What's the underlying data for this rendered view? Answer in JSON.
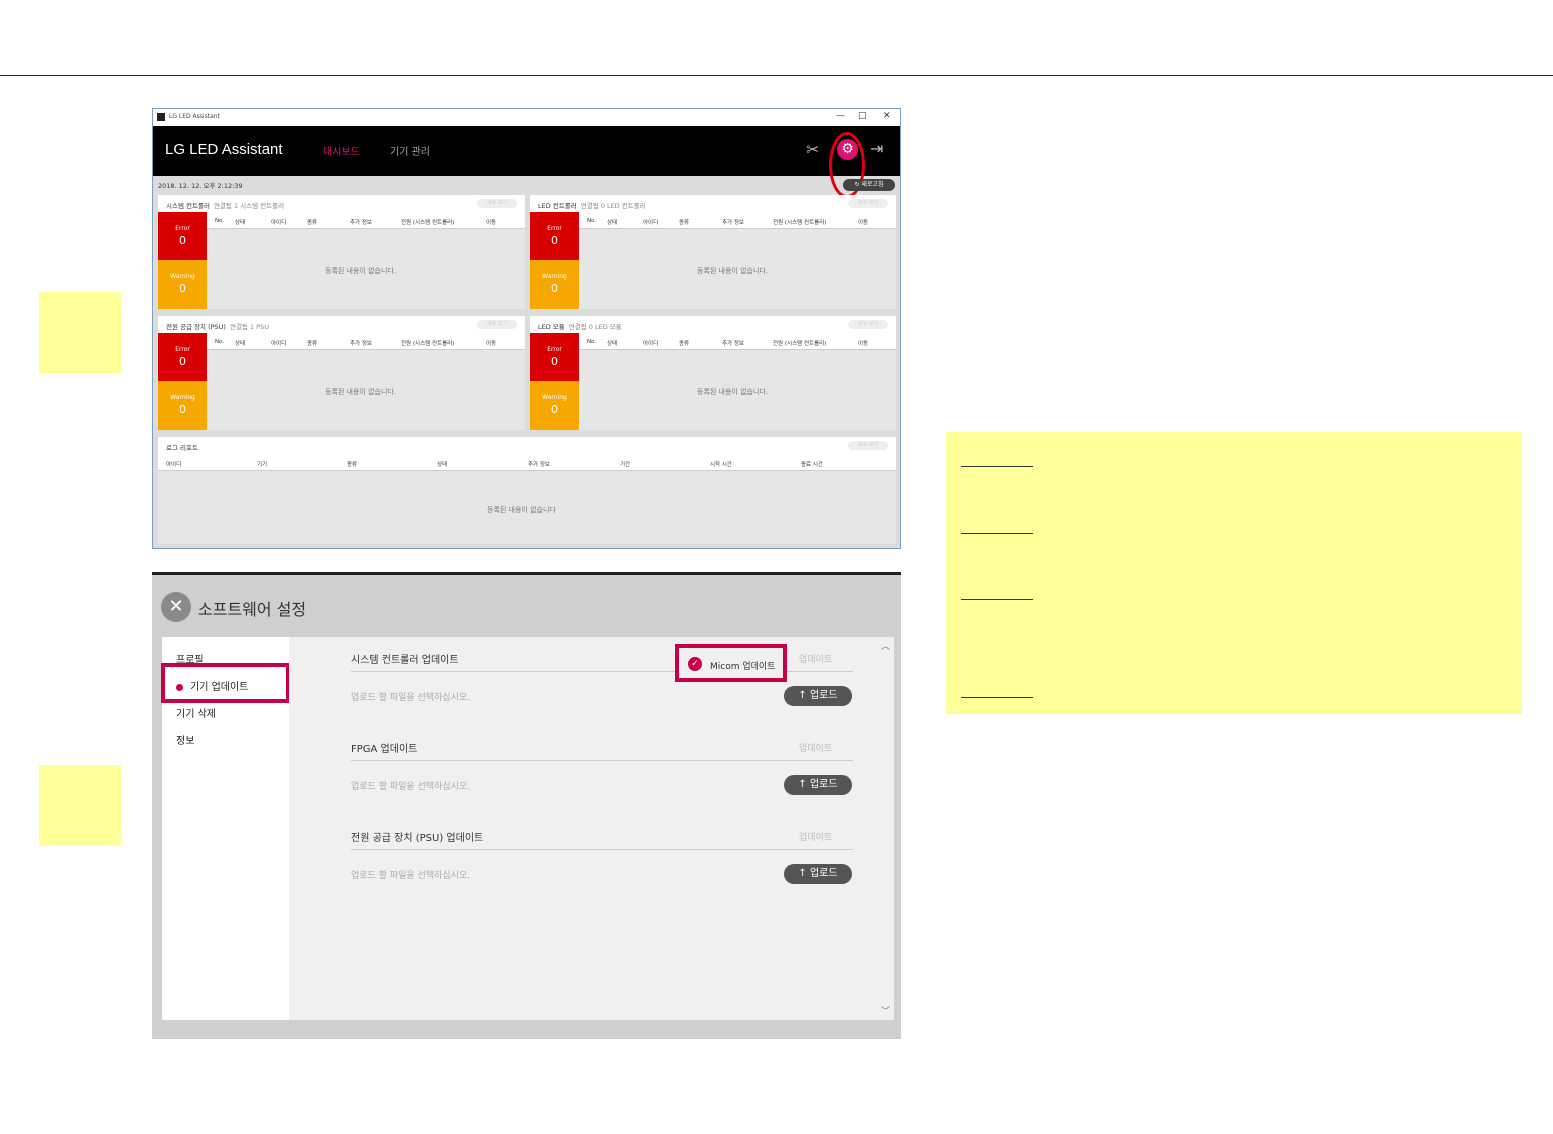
{
  "window1": {
    "titlebar": {
      "title": "LG LED Assistant",
      "minimize": "—",
      "maximize": "□",
      "close": "✕"
    },
    "header": {
      "brand": "LG LED Assistant",
      "nav": [
        "대시보드",
        "기기 관리"
      ]
    },
    "datetime": "2018. 12. 12. 오후 2:12:39",
    "refresh_label": "새로고침",
    "panels": [
      {
        "title": "시스템 컨트롤러",
        "sub": "연결됨   1 시스템 컨트롤러",
        "view_all": "모두 보기",
        "columns": [
          "No.",
          "상태",
          "아이디",
          "종류",
          "추가 정보",
          "전원 (시스템 컨트롤러)",
          "이동"
        ],
        "error_label": "Error",
        "error_count": "0",
        "warning_label": "Warning",
        "warning_count": "0",
        "empty": "등록된 내용이 없습니다."
      },
      {
        "title": "LED 컨트롤러",
        "sub": "연결됨   0 LED 컨트롤러",
        "view_all": "모두 보기",
        "columns": [
          "No.",
          "상태",
          "아이디",
          "종류",
          "추가 정보",
          "전원 (시스템 컨트롤러)",
          "이동"
        ],
        "error_label": "Error",
        "error_count": "0",
        "warning_label": "Warning",
        "warning_count": "0",
        "empty": "등록된 내용이 없습니다."
      },
      {
        "title": "전원 공급 장치 (PSU)",
        "sub": "연결됨   1 PSU",
        "view_all": "모두 보기",
        "columns": [
          "No.",
          "상태",
          "아이디",
          "종류",
          "추가 정보",
          "전원 (시스템 컨트롤러)",
          "이동"
        ],
        "error_label": "Error",
        "error_count": "0",
        "warning_label": "Warning",
        "warning_count": "0",
        "empty": "등록된 내용이 없습니다."
      },
      {
        "title": "LED 모듈",
        "sub": "연결됨   0 LED 모듈",
        "view_all": "모두 보기",
        "columns": [
          "No.",
          "상태",
          "아이디",
          "종류",
          "추가 정보",
          "전원 (시스템 컨트롤러)",
          "이동"
        ],
        "error_label": "Error",
        "error_count": "0",
        "warning_label": "Warning",
        "warning_count": "0",
        "empty": "등록된 내용이 없습니다."
      }
    ],
    "log": {
      "title": "로그 리포트",
      "view_all": "모두 보기",
      "columns": [
        "아이디",
        "기기",
        "종류",
        "상태",
        "추가 정보",
        "기간",
        "시작 시간",
        "종료 시간"
      ],
      "empty": "등록된 내용이 없습니다"
    }
  },
  "window2": {
    "close": "✕",
    "title": "소프트웨어 설정",
    "sidebar": [
      "프로필",
      "기기 업데이트",
      "기기 삭제",
      "정보"
    ],
    "sections": [
      {
        "title": "시스템 컨트롤러 업데이트",
        "update": "업데이트",
        "placeholder": "업로드 할 파일을 선택하십시오.",
        "upload": "업로드"
      },
      {
        "title": "FPGA 업데이트",
        "update": "업데이트",
        "placeholder": "업로드 할 파일을 선택하십시오.",
        "upload": "업로드"
      },
      {
        "title": "전원 공급 장치 (PSU) 업데이트",
        "update": "업데이트",
        "placeholder": "업로드 할 파일을 선택하십시오.",
        "upload": "업로드"
      }
    ],
    "micom_label": "Micom 업데이트"
  },
  "colors": {
    "accent": "#e2116e",
    "highlight": "#c8004c",
    "error": "#d80000",
    "warning": "#f6a800",
    "sticky": "#ffff99"
  }
}
